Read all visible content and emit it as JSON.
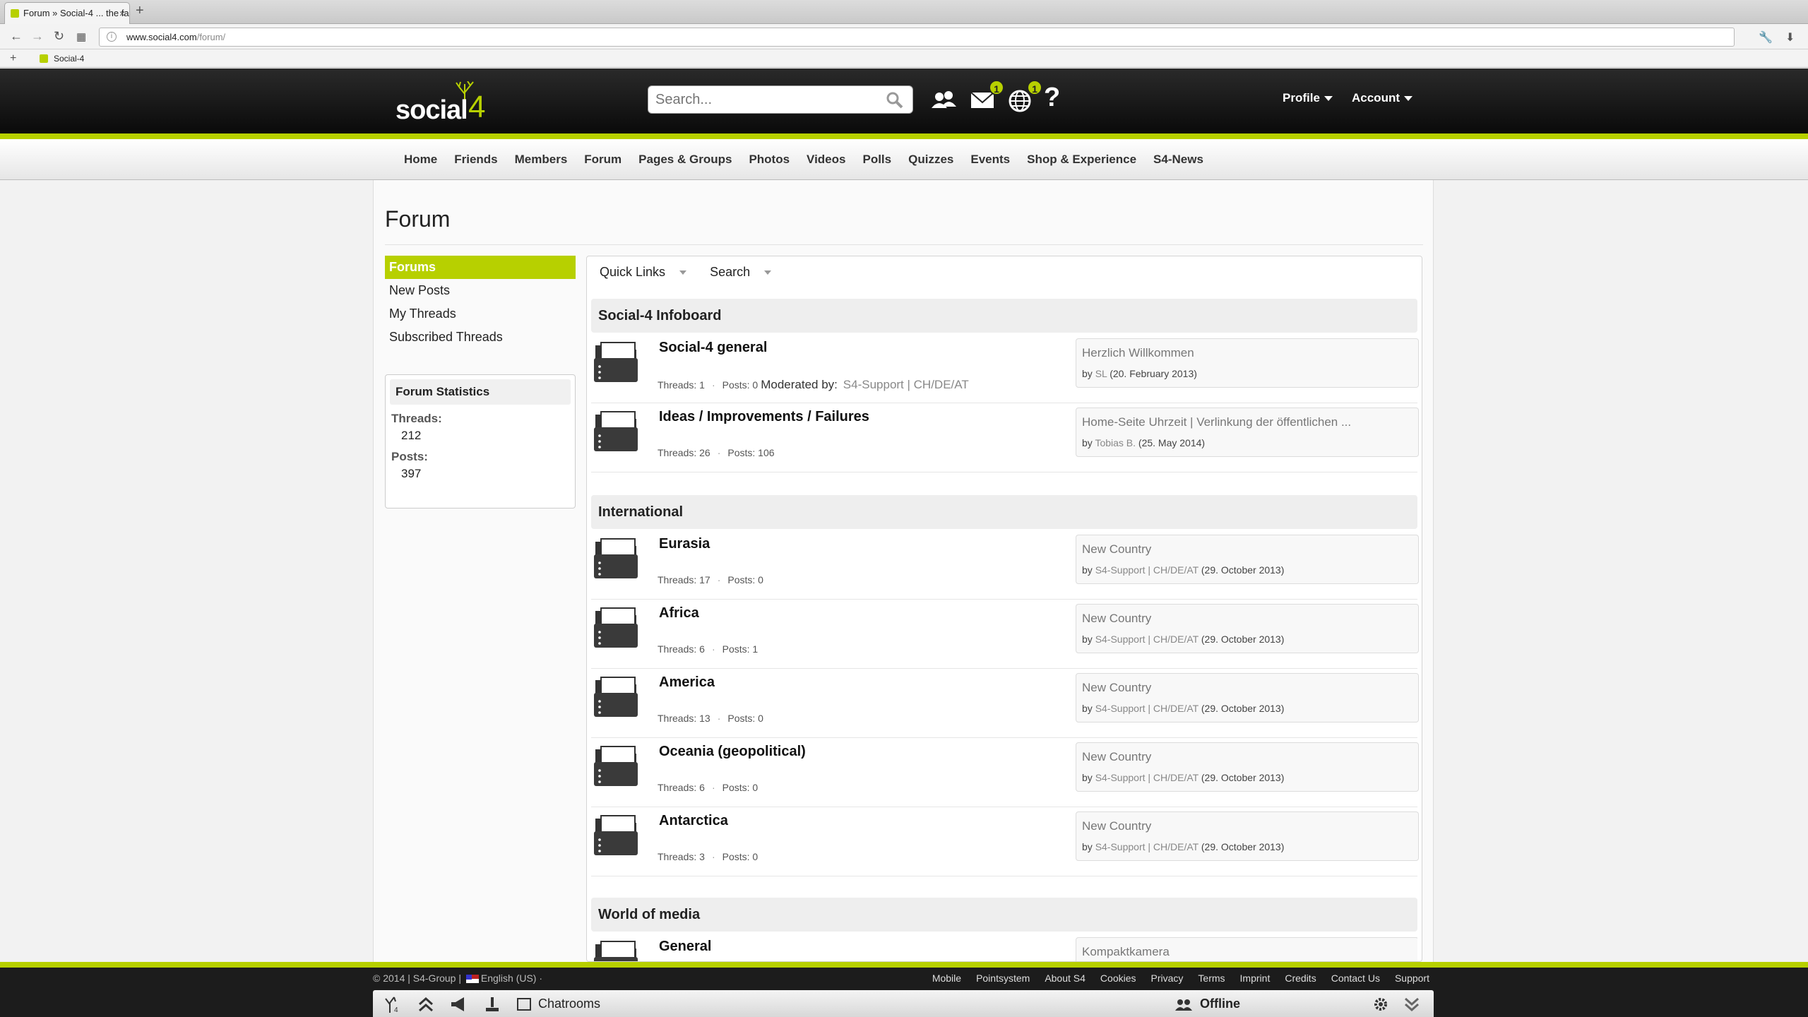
{
  "browser": {
    "tab_title": "Forum » Social-4 ... the fa",
    "url_domain": "www.social4.com",
    "url_path": "/forum/",
    "bookmark": "Social-4"
  },
  "header": {
    "search_placeholder": "Search...",
    "messages_badge": "1",
    "notifications_badge": "1",
    "help": "?",
    "profile": "Profile",
    "account": "Account"
  },
  "nav": [
    "Home",
    "Friends",
    "Members",
    "Forum",
    "Pages & Groups",
    "Photos",
    "Videos",
    "Polls",
    "Quizzes",
    "Events",
    "Shop & Experience",
    "S4-News"
  ],
  "page": {
    "title": "Forum"
  },
  "sidebar": {
    "items": [
      "Forums",
      "New Posts",
      "My Threads",
      "Subscribed Threads"
    ],
    "stats_title": "Forum Statistics",
    "threads_label": "Threads:",
    "threads_value": "212",
    "posts_label": "Posts:",
    "posts_value": "397"
  },
  "toolbar": {
    "quick_links": "Quick Links",
    "search": "Search"
  },
  "categories": [
    {
      "title": "Social-4 Infoboard"
    },
    {
      "title": "International"
    },
    {
      "title": "World of media"
    }
  ],
  "forums": [
    {
      "name": "Social-4 general",
      "threads": "Threads: 1",
      "posts": "Posts: 0",
      "moderated_label": "Moderated by:",
      "moderated_value": "S4-Support | CH/DE/AT",
      "last_title": "Herzlich Willkommen",
      "by": "by",
      "last_author": "SL",
      "last_date": "(20. February 2013)"
    },
    {
      "name": "Ideas / Improvements / Failures",
      "threads": "Threads: 26",
      "posts": "Posts: 106",
      "last_title": "Home-Seite Uhrzeit | Verlinkung der öffentlichen ...",
      "by": "by",
      "last_author": "Tobias B.",
      "last_date": "(25. May 2014)"
    },
    {
      "name": "Eurasia",
      "threads": "Threads: 17",
      "posts": "Posts: 0",
      "last_title": "New Country",
      "by": "by",
      "last_author": "S4-Support | CH/DE/AT",
      "last_date": "(29. October 2013)"
    },
    {
      "name": "Africa",
      "threads": "Threads: 6",
      "posts": "Posts: 1",
      "last_title": "New Country",
      "by": "by",
      "last_author": "S4-Support | CH/DE/AT",
      "last_date": "(29. October 2013)"
    },
    {
      "name": "America",
      "threads": "Threads: 13",
      "posts": "Posts: 0",
      "last_title": "New Country",
      "by": "by",
      "last_author": "S4-Support | CH/DE/AT",
      "last_date": "(29. October 2013)"
    },
    {
      "name": "Oceania (geopolitical)",
      "threads": "Threads: 6",
      "posts": "Posts: 0",
      "last_title": "New Country",
      "by": "by",
      "last_author": "S4-Support | CH/DE/AT",
      "last_date": "(29. October 2013)"
    },
    {
      "name": "Antarctica",
      "threads": "Threads: 3",
      "posts": "Posts: 0",
      "last_title": "New Country",
      "by": "by",
      "last_author": "S4-Support | CH/DE/AT",
      "last_date": "(29. October 2013)"
    },
    {
      "name": "General",
      "last_title": "Kompaktkamera"
    }
  ],
  "footer": {
    "copyright": "© 2014 | S4-Group |",
    "language": "English (US) ·",
    "links": [
      "Mobile",
      "Pointsystem",
      "About S4",
      "Cookies",
      "Privacy",
      "Terms",
      "Imprint",
      "Credits",
      "Contact Us",
      "Support"
    ],
    "chatrooms": "Chatrooms",
    "status": "Offline"
  },
  "colors": {
    "accent": "#b7d000",
    "header_bg": "#111111"
  }
}
